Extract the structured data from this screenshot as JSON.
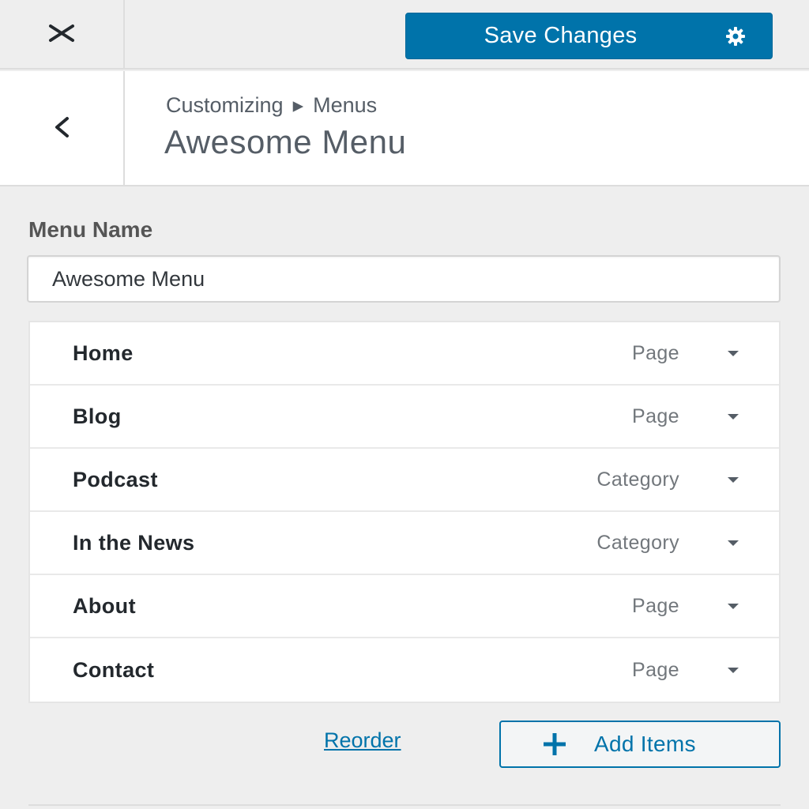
{
  "topbar": {
    "close_icon": "close-icon",
    "save_label": "Save Changes",
    "settings_icon": "gear-icon"
  },
  "header": {
    "back_icon": "chevron-left-icon",
    "breadcrumb_parent": "Customizing",
    "breadcrumb_separator": "▸",
    "breadcrumb_current": "Menus",
    "title": "Awesome Menu"
  },
  "menu_name": {
    "label": "Menu Name",
    "value": "Awesome Menu"
  },
  "items": [
    {
      "title": "Home",
      "type": "Page"
    },
    {
      "title": "Blog",
      "type": "Page"
    },
    {
      "title": "Podcast",
      "type": "Category"
    },
    {
      "title": "In the News",
      "type": "Category"
    },
    {
      "title": "About",
      "type": "Page"
    },
    {
      "title": "Contact",
      "type": "Page"
    }
  ],
  "actions": {
    "reorder_label": "Reorder",
    "add_items_label": "Add Items",
    "add_icon": "plus-icon"
  },
  "colors": {
    "accent": "#0073aa",
    "background": "#eeeeee",
    "panel": "#ffffff"
  }
}
